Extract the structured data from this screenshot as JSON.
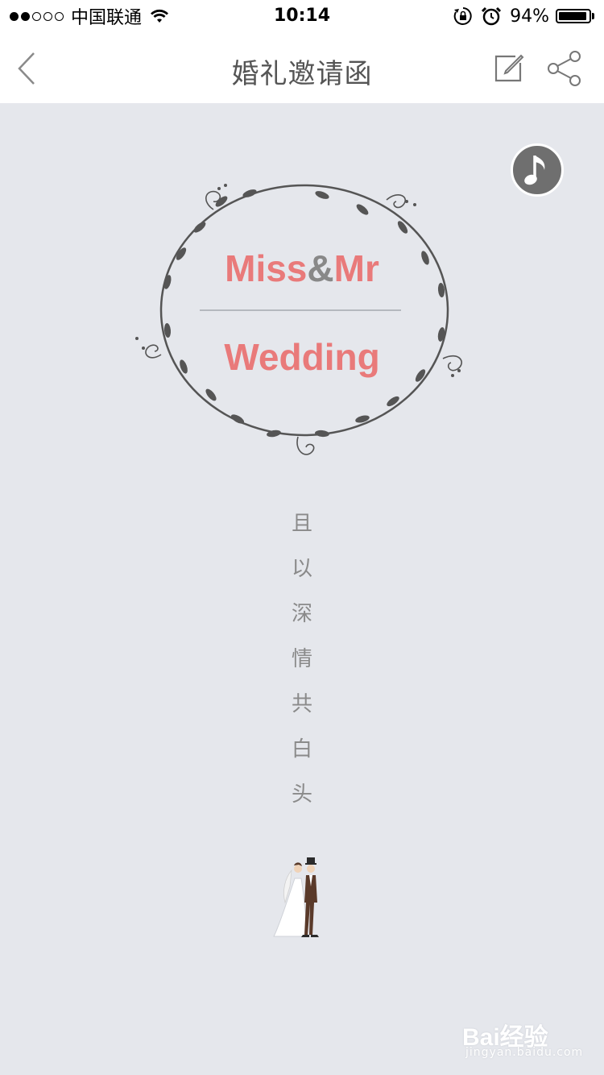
{
  "status_bar": {
    "carrier": "中国联通",
    "time": "10:14",
    "battery": "94%",
    "battery_level": 0.94,
    "signal_bars_filled": 2,
    "signal_bars_total": 5
  },
  "nav": {
    "title": "婚礼邀请函"
  },
  "invitation": {
    "miss": "Miss",
    "amp": "&",
    "mr": "Mr",
    "wedding": "Wedding",
    "vertical_chars": [
      "且",
      "以",
      "深",
      "情",
      "共",
      "白",
      "头"
    ]
  },
  "watermark": {
    "brand": "Bai经验",
    "url": "jingyan.baidu.com"
  },
  "colors": {
    "accent": "#e97a7a",
    "background": "#e5e7ec",
    "music_button": "#6f6f6f"
  },
  "icons": [
    "back-icon",
    "edit-icon",
    "share-icon",
    "music-note-icon",
    "wreath-decoration",
    "wedding-couple-illustration"
  ]
}
